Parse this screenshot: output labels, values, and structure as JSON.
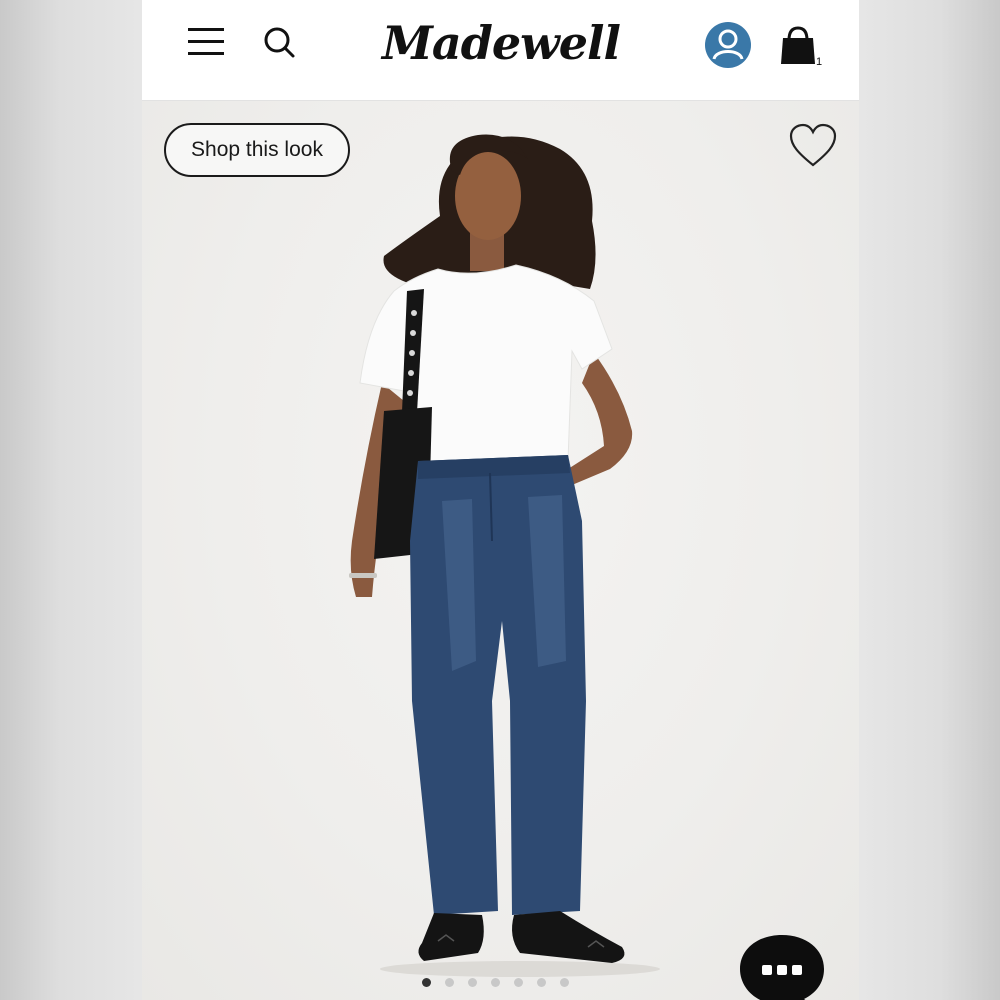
{
  "header": {
    "logo_text": "Madewell",
    "menu_icon": "hamburger-menu-icon",
    "search_icon": "search-icon",
    "account_icon": "account-icon",
    "bag_icon": "shopping-bag-icon",
    "bag_count": "1",
    "accent_color": "#3a78a8"
  },
  "hero": {
    "shop_look_label": "Shop this look",
    "favorite_icon": "heart-icon",
    "background_color": "#efeeec"
  },
  "carousel": {
    "total_slides": 7,
    "active_slide": 1
  },
  "chat": {
    "icon": "chat-bubble-icon"
  }
}
